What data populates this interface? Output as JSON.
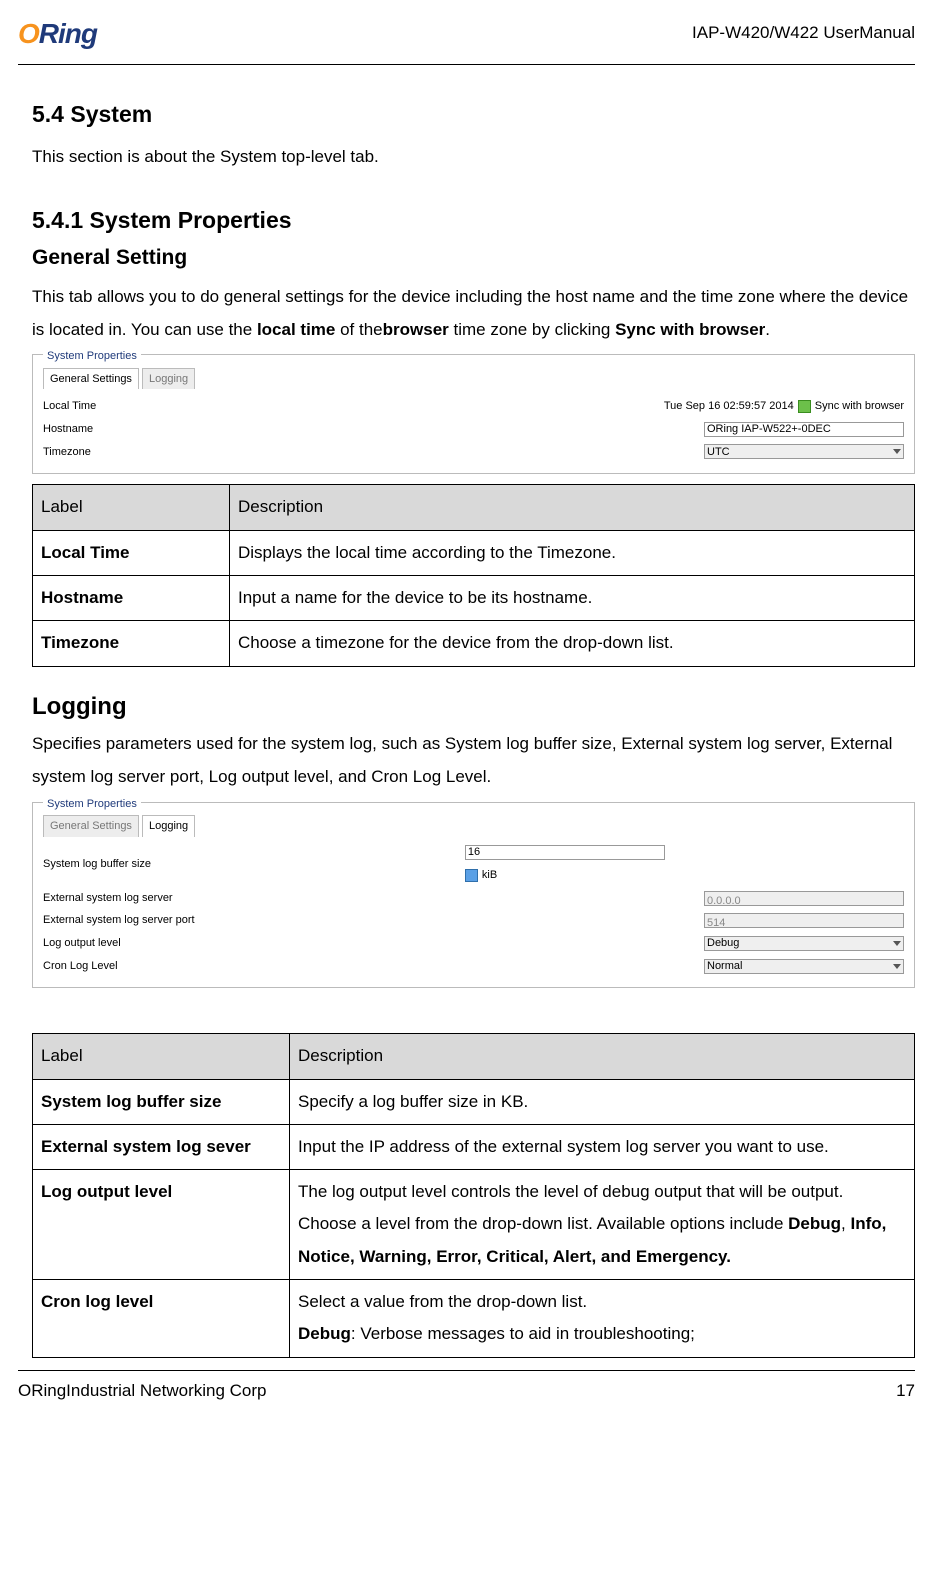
{
  "header": {
    "logo_o": "O",
    "logo_ring": "Ring",
    "doc_title": "IAP-W420/W422  UserManual"
  },
  "section": {
    "num_title": "5.4 System",
    "intro": "This section is about the System top-level tab."
  },
  "subsection": {
    "num_title": "5.4.1 System Properties",
    "heading": "General Setting",
    "para_a": "This tab allows you to do general settings for the device including the host name and the time zone where the device is located in. You can use the ",
    "local_time": "local time",
    "para_b": " of the",
    "browser": "browser",
    "para_c": " time zone by clicking ",
    "sync": "Sync with browser",
    "para_d": "."
  },
  "fig1": {
    "legend": "System Properties",
    "tab_active": "General Settings",
    "tab_inactive": "Logging",
    "rows": {
      "localtime": "Local Time",
      "localtime_val": "Tue Sep 16 02:59:57 2014",
      "sync_link": "Sync with browser",
      "hostname": "Hostname",
      "hostname_val": "ORing IAP-W522+-0DEC",
      "timezone": "Timezone",
      "timezone_val": "UTC"
    }
  },
  "table1": {
    "h1": "Label",
    "h2": "Description",
    "r1c1": "Local Time",
    "r1c2": "Displays the local time according to the Timezone.",
    "r2c1": "Hostname",
    "r2c2": "Input a name for the device to be its hostname.",
    "r3c1": "Timezone",
    "r3c2": "Choose a timezone for the device from the drop-down list."
  },
  "logging": {
    "heading": "Logging",
    "para": "Specifies parameters used for the system log, such as System log buffer size, External system log server, External system log server port, Log output level, and Cron Log Level."
  },
  "fig2": {
    "legend": "System Properties",
    "tab_inactive": "General Settings",
    "tab_active": "Logging",
    "rows": {
      "bufsize": "System log buffer size",
      "bufsize_val": "16",
      "bufsize_hint": "kiB",
      "extsrv": "External system log server",
      "extsrv_val": "0.0.0.0",
      "extport": "External system log server port",
      "extport_val": "514",
      "loglvl": "Log output level",
      "loglvl_val": "Debug",
      "cronlvl": "Cron Log Level",
      "cronlvl_val": "Normal"
    }
  },
  "table2": {
    "h1": "Label",
    "h2": "Description",
    "r1c1": "System log buffer size",
    "r1c2": "Specify a log buffer size in KB.",
    "r2c1": "External system log sever",
    "r2c2": "Input the IP address of the external system log server you want to use.",
    "r3c1": "Log output level",
    "r3c2a": "The log output level controls the level of debug output that will be output. Choose a level from the drop-down list. Available options include ",
    "r3c2_debug": "Debug",
    "r3c2b": ", ",
    "r3c2_rest": "Info, Notice, Warning, Error, Critical, Alert, and Emergency.",
    "r4c1": "Cron log level",
    "r4c2a": "Select a value from the drop-down list.",
    "r4c2_debug": "Debug",
    "r4c2b": ": Verbose messages to aid in troubleshooting;"
  },
  "footer": {
    "left": "ORingIndustrial Networking Corp",
    "right": "17"
  }
}
